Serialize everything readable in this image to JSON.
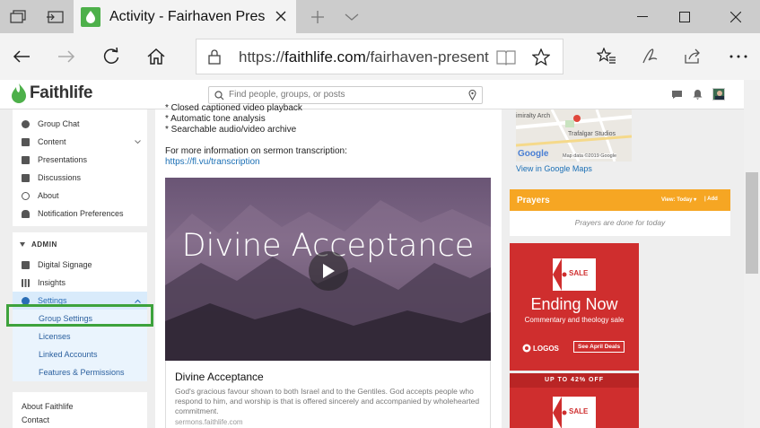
{
  "browser": {
    "tab_title": "Activity - Fairhaven Pres",
    "url_domain": "faithlife.com",
    "url_prefix": "https://",
    "url_rest": "/fairhaven-present"
  },
  "header": {
    "logo_text": "Faithlife",
    "search_placeholder": "Find people, groups, or posts"
  },
  "sidebar": {
    "group_items": [
      {
        "label": "Group Chat",
        "icon": "chat-icon"
      },
      {
        "label": "Content",
        "icon": "folder-icon"
      },
      {
        "label": "Presentations",
        "icon": "presentation-icon"
      },
      {
        "label": "Discussions",
        "icon": "discussion-icon"
      },
      {
        "label": "About",
        "icon": "info-icon"
      },
      {
        "label": "Notification Preferences",
        "icon": "bell-icon"
      }
    ],
    "admin_label": "ADMIN",
    "admin_items": [
      {
        "label": "Digital Signage"
      },
      {
        "label": "Insights"
      },
      {
        "label": "Settings"
      }
    ],
    "settings_sub": [
      "Group Settings",
      "Licenses",
      "Linked Accounts",
      "Features & Permissions"
    ],
    "footer_items": [
      "About Faithlife",
      "Contact"
    ]
  },
  "main": {
    "line_partial": "* Closed captioned video playback",
    "line2": "* Automatic tone analysis",
    "line3": "* Searchable audio/video archive",
    "more_info": "For more information on sermon transcription:",
    "link": "https://fl.vu/transcription",
    "video_title": "Divine Acceptance",
    "card_title": "Divine Acceptance",
    "card_desc": "God's gracious favour shown to both Israel and to the Gentiles. God accepts people who respond to him, and worship is that is offered sincerely and accompanied by wholehearted commitment.",
    "card_source": "sermons.faithlife.com"
  },
  "right": {
    "map_label_1": "imiralty Arch",
    "map_label_2": "Trafalgar Studios",
    "map_google": "Google",
    "map_data": "Map data ©2019 Google",
    "view_in_maps": "View in Google Maps",
    "prayers_title": "Prayers",
    "prayers_view": "View: Today",
    "prayers_add": "Add",
    "prayers_empty": "Prayers are done for today",
    "ad1_badge": "SALE",
    "ad1_headline": "Ending Now",
    "ad1_sub": "Commentary and theology sale",
    "ad1_brand": "LOGOS",
    "ad1_cta": "See April Deals",
    "ad2_top": "UP TO 42% OFF",
    "ad2_badge": "SALE"
  },
  "colors": {
    "accent_green": "#3da23c",
    "prayers_orange": "#f6a623",
    "ad_red": "#cf2e2e",
    "link_blue": "#1a6fb5"
  }
}
